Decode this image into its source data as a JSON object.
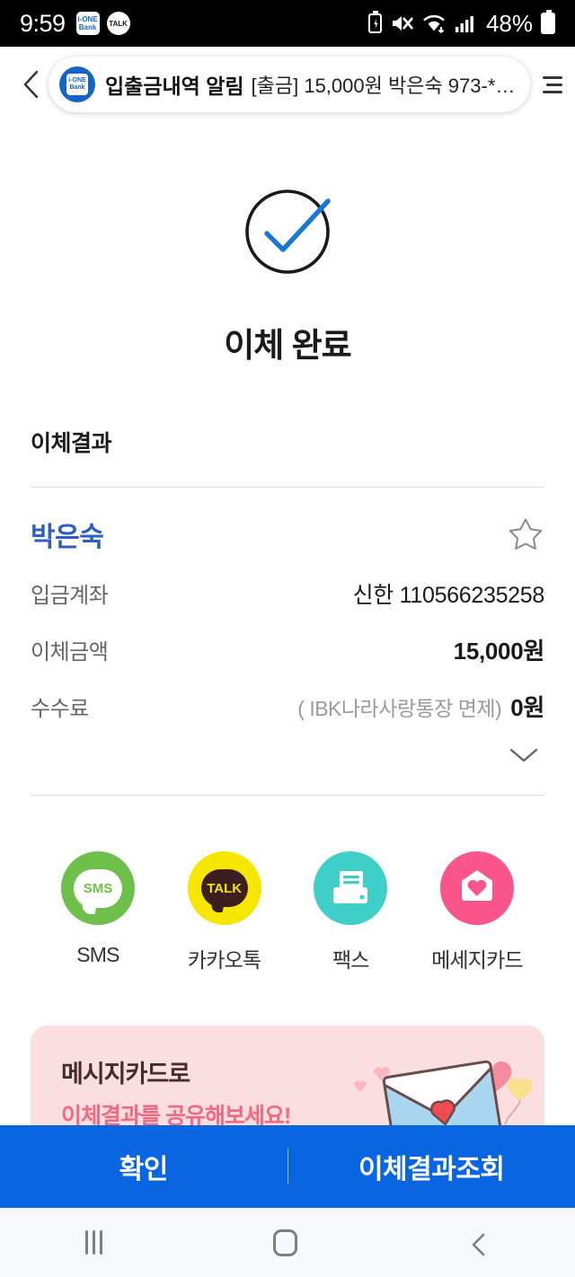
{
  "status_bar": {
    "clock": "9:59",
    "battery_percent": "48%",
    "app_icons": [
      "i-ONE Bank",
      "TALK"
    ],
    "icons": [
      "battery-saver-icon",
      "mute-icon",
      "wifi-icon",
      "signal-icon",
      "battery-icon"
    ]
  },
  "notification": {
    "back_icon": "back-chevron-icon",
    "app_icon_label": "i-ONE Bank",
    "title": "입출금내역 알림",
    "body": "[출금] 15,000원 박은숙 973-***...",
    "menu_icon": "hamburger-menu-icon"
  },
  "hero": {
    "icon": "check-circle-icon",
    "title": "이체 완료",
    "check_color": "#1877d2",
    "circle_color": "#1a1a1a"
  },
  "result": {
    "section_heading": "이체결과",
    "payee_name": "박은숙",
    "payee_color": "#2c5fc4",
    "favorite_icon": "star-outline-icon",
    "rows": [
      {
        "label": "입금계좌",
        "value": "신한 110566235258",
        "note": "",
        "bold": false
      },
      {
        "label": "이체금액",
        "value": "15,000원",
        "note": "",
        "bold": true
      },
      {
        "label": "수수료",
        "value": "0원",
        "note": "( IBK나라사랑통장 면제)",
        "bold": true
      }
    ],
    "expand_icon": "chevron-down-icon"
  },
  "share": {
    "items": [
      {
        "label": "SMS",
        "icon": "sms-icon",
        "color": "#6ec04a",
        "glyph": "SMS"
      },
      {
        "label": "카카오톡",
        "icon": "kakaotalk-icon",
        "color": "#f7e600",
        "glyph": "TALK"
      },
      {
        "label": "팩스",
        "icon": "fax-icon",
        "color": "#3fcfc8",
        "glyph": ""
      },
      {
        "label": "메세지카드",
        "icon": "message-card-icon",
        "color": "#f9558b",
        "glyph": ""
      }
    ]
  },
  "promo": {
    "line1": "메시지카드로",
    "line2": "이체결과를 공유해보세요!",
    "background": "#fbdfe0",
    "illustration": "envelope-with-heart-balloons-icon"
  },
  "bottom_bar": {
    "background": "#0a66e0",
    "primary_label": "확인",
    "secondary_label": "이체결과조회"
  },
  "nav_bar": {
    "recents_icon": "recents-icon",
    "home_icon": "home-icon",
    "back_icon": "back-icon"
  }
}
